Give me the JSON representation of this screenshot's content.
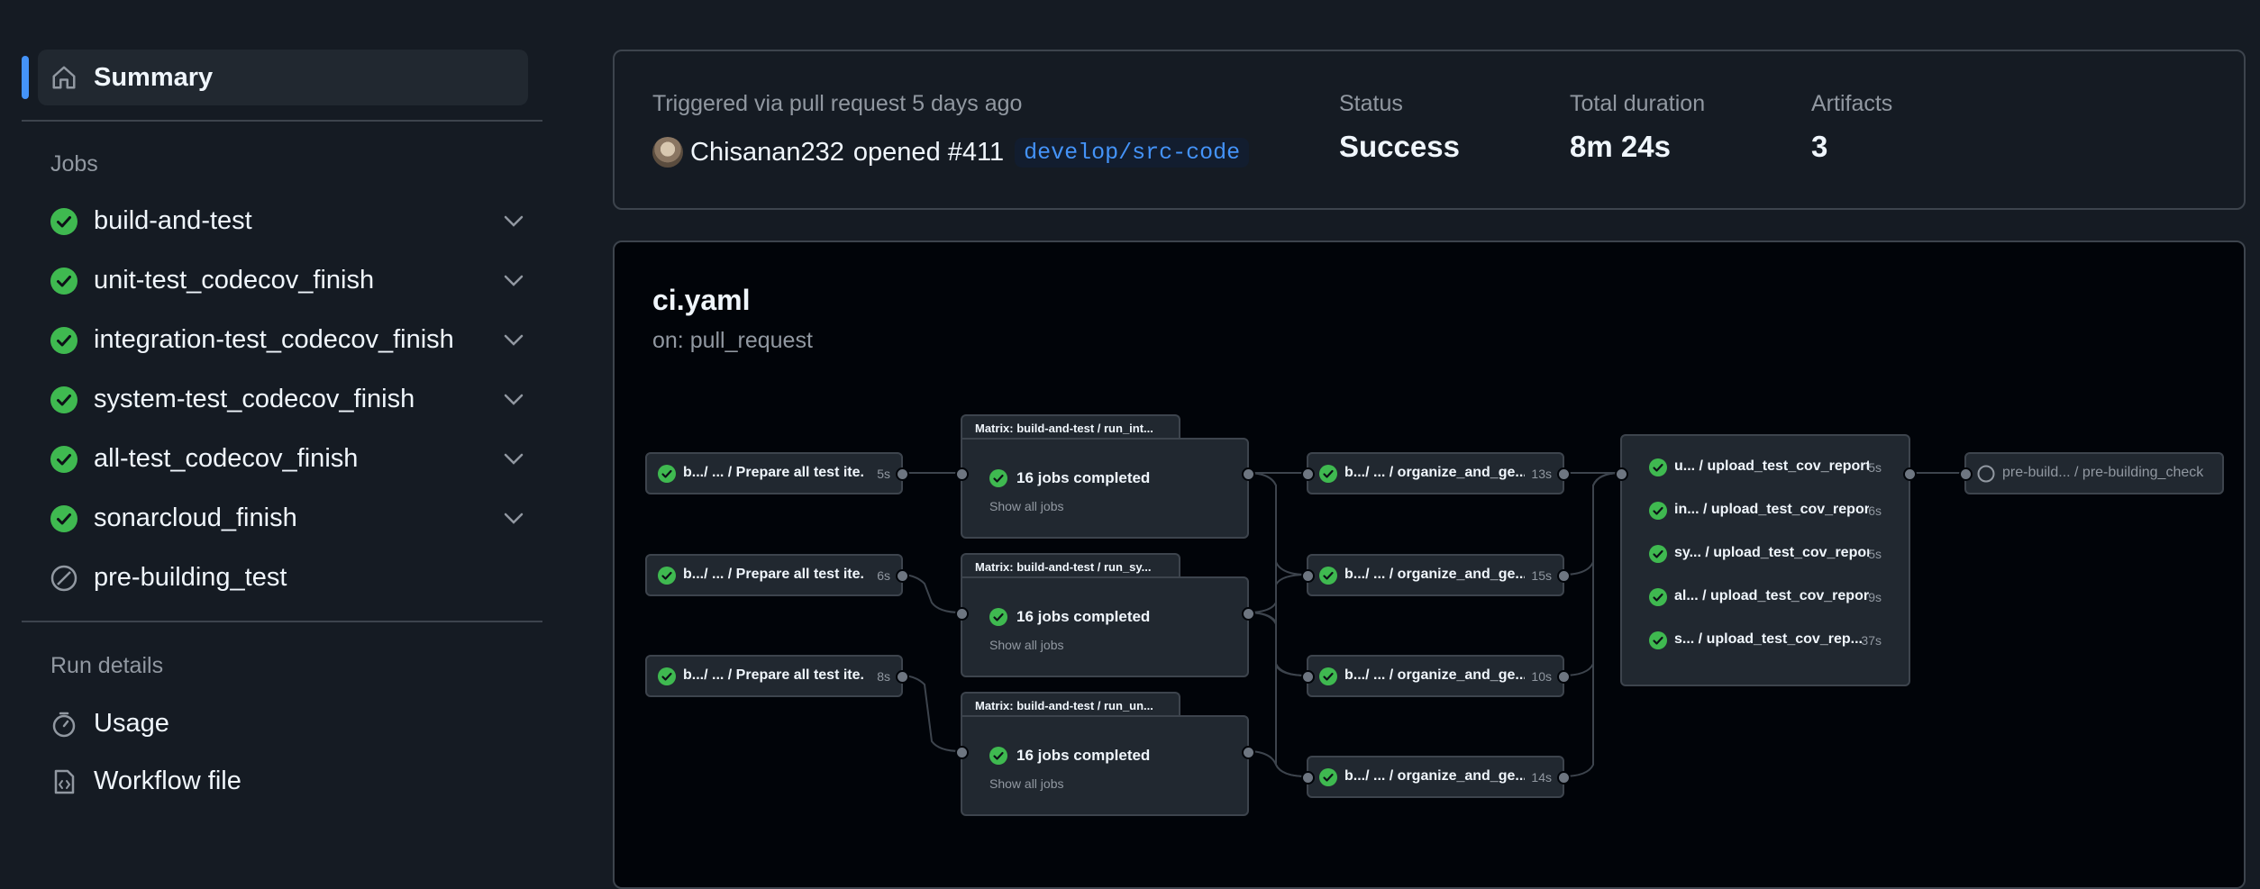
{
  "sidebar": {
    "summary_label": "Summary",
    "jobs_heading": "Jobs",
    "jobs": [
      {
        "label": "build-and-test",
        "status": "success"
      },
      {
        "label": "unit-test_codecov_finish",
        "status": "success"
      },
      {
        "label": "integration-test_codecov_finish",
        "status": "success"
      },
      {
        "label": "system-test_codecov_finish",
        "status": "success"
      },
      {
        "label": "all-test_codecov_finish",
        "status": "success"
      },
      {
        "label": "sonarcloud_finish",
        "status": "success"
      },
      {
        "label": "pre-building_test",
        "status": "skipped"
      }
    ],
    "run_details_heading": "Run details",
    "usage_label": "Usage",
    "workflow_file_label": "Workflow file"
  },
  "summary": {
    "trigger_text": "Triggered via pull request 5 days ago",
    "user": "Chisanan232",
    "action": "opened #411",
    "branch": "develop/src-code",
    "status_label": "Status",
    "status_value": "Success",
    "duration_label": "Total duration",
    "duration_value": "8m 24s",
    "artifacts_label": "Artifacts",
    "artifacts_value": "3"
  },
  "workflow": {
    "title": "ci.yaml",
    "trigger": "on: pull_request",
    "prepare_jobs": [
      {
        "label": "b.../ ... / Prepare all test ite...",
        "duration": "5s"
      },
      {
        "label": "b.../ ... / Prepare all test ite...",
        "duration": "6s"
      },
      {
        "label": "b.../ ... / Prepare all test ite...",
        "duration": "8s"
      }
    ],
    "matrices": [
      {
        "tab": "Matrix: build-and-test / run_int...",
        "summary": "16 jobs completed",
        "link": "Show all jobs"
      },
      {
        "tab": "Matrix: build-and-test / run_sy...",
        "summary": "16 jobs completed",
        "link": "Show all jobs"
      },
      {
        "tab": "Matrix: build-and-test / run_un...",
        "summary": "16 jobs completed",
        "link": "Show all jobs"
      }
    ],
    "organize_jobs": [
      {
        "label": "b.../ ... / organize_and_ge...",
        "duration": "13s"
      },
      {
        "label": "b.../ ... / organize_and_ge...",
        "duration": "15s"
      },
      {
        "label": "b.../ ... / organize_and_ge...",
        "duration": "10s"
      },
      {
        "label": "b.../ ... / organize_and_ge...",
        "duration": "14s"
      }
    ],
    "upload_jobs": [
      {
        "label": "u... / upload_test_cov_report",
        "duration": "5s"
      },
      {
        "label": "in... / upload_test_cov_report",
        "duration": "6s"
      },
      {
        "label": "sy... / upload_test_cov_report",
        "duration": "5s"
      },
      {
        "label": "al... / upload_test_cov_report",
        "duration": "9s"
      },
      {
        "label": "s... / upload_test_cov_rep...",
        "duration": "37s"
      }
    ],
    "final_job": {
      "label": "pre-build... / pre-building_check",
      "status": "pending"
    }
  }
}
